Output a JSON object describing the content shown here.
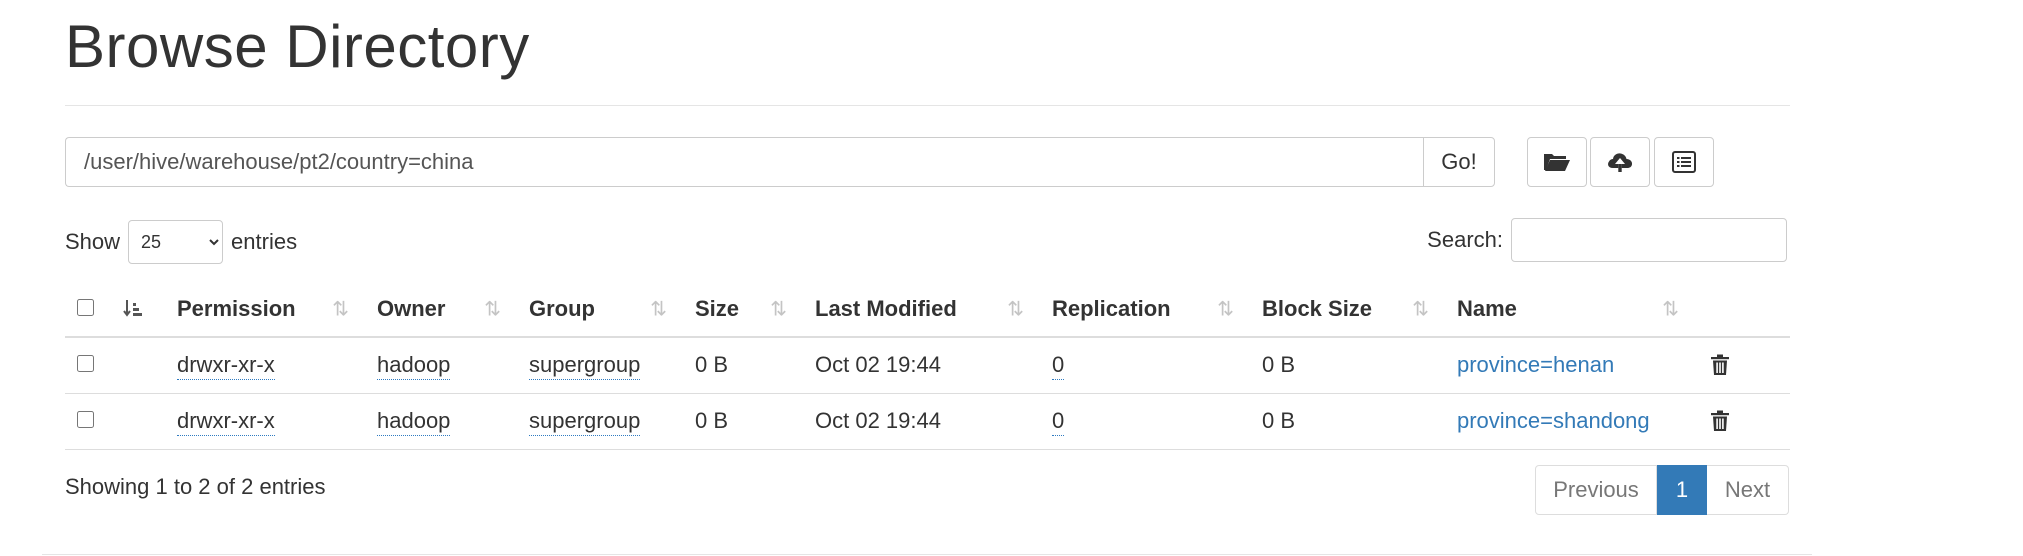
{
  "title": "Browse Directory",
  "path": {
    "value": "/user/hive/warehouse/pt2/country=china",
    "go_label": "Go!"
  },
  "toolbar": {
    "create_dir_icon": "folder-open-icon",
    "upload_icon": "cloud-upload-icon",
    "cut_paste_icon": "list-alt-icon"
  },
  "length_menu": {
    "show_label": "Show",
    "selected": "25",
    "entries_label": "entries"
  },
  "search": {
    "label": "Search:",
    "value": ""
  },
  "table": {
    "headers": [
      "Permission",
      "Owner",
      "Group",
      "Size",
      "Last Modified",
      "Replication",
      "Block Size",
      "Name"
    ],
    "rows": [
      {
        "permission": "drwxr-xr-x",
        "owner": "hadoop",
        "group": "supergroup",
        "size": "0 B",
        "last_modified": "Oct 02 19:44",
        "replication": "0",
        "block_size": "0 B",
        "name": "province=henan"
      },
      {
        "permission": "drwxr-xr-x",
        "owner": "hadoop",
        "group": "supergroup",
        "size": "0 B",
        "last_modified": "Oct 02 19:44",
        "replication": "0",
        "block_size": "0 B",
        "name": "province=shandong"
      }
    ]
  },
  "footer": {
    "info": "Showing 1 to 2 of 2 entries",
    "previous": "Previous",
    "current_page": "1",
    "next": "Next"
  },
  "colors": {
    "link": "#337ab7",
    "active_page": "#337ab7",
    "border": "#dddddd"
  }
}
